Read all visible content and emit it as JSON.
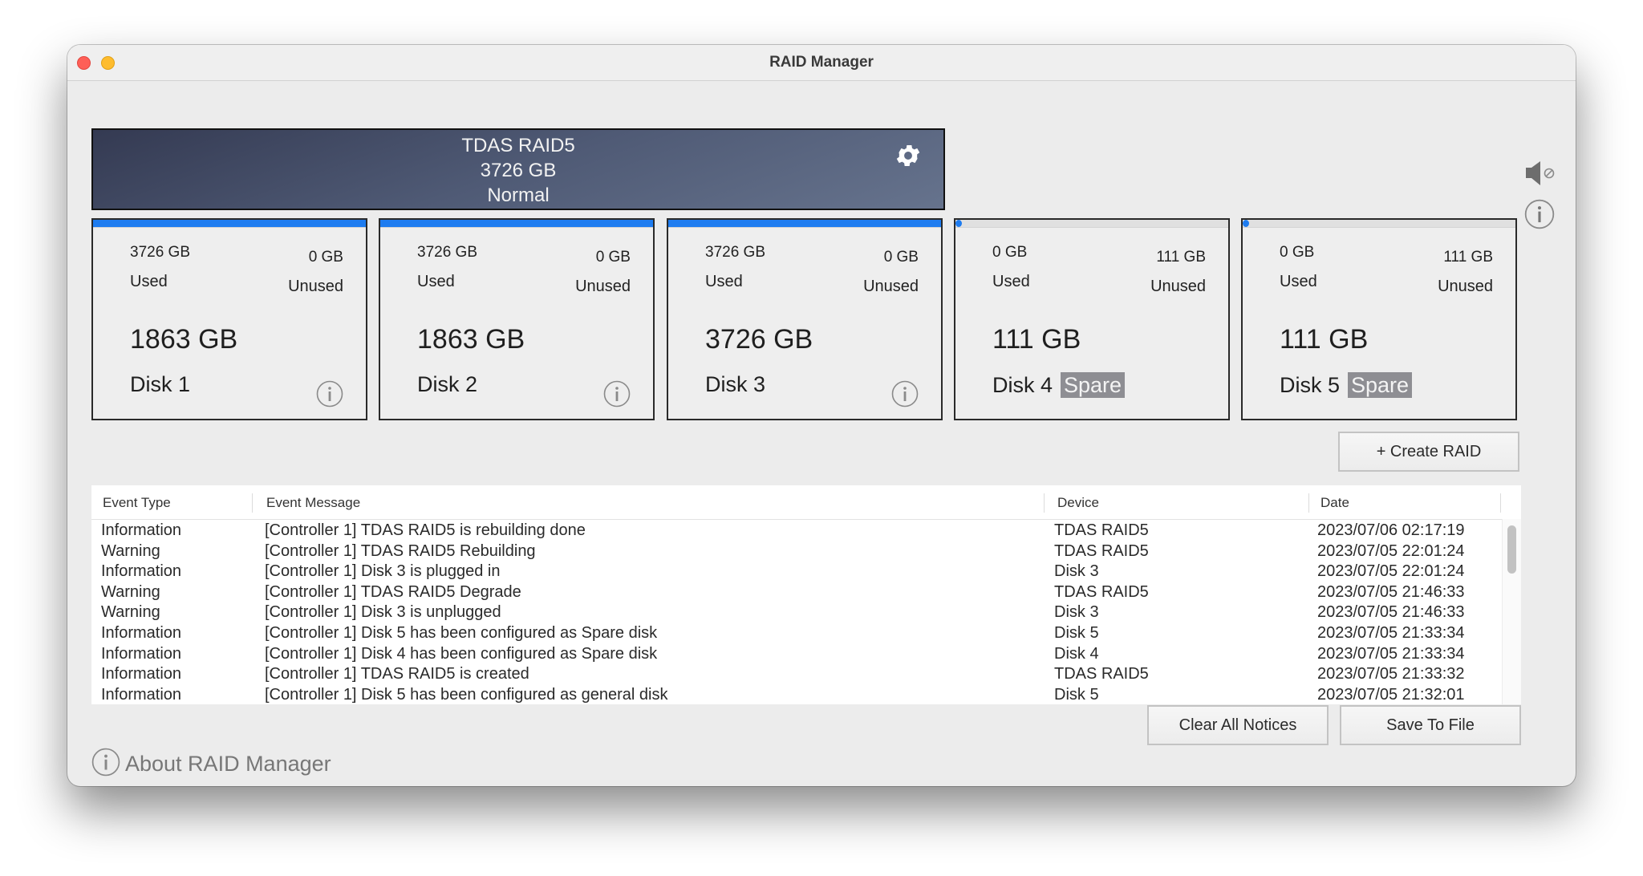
{
  "window": {
    "title": "RAID Manager"
  },
  "raid": {
    "name": "TDAS RAID5",
    "capacity": "3726 GB",
    "status": "Normal"
  },
  "colors": {
    "accent_blue": "#1e7cf0",
    "close": "#fe5f57",
    "minimize": "#febc2e",
    "spare_badge": "#8e8e93"
  },
  "disks": [
    {
      "used_value": "3726 GB",
      "used_label": "Used",
      "unused_value": "0 GB",
      "unused_label": "Unused",
      "size": "1863 GB",
      "name": "Disk 1",
      "badge": "",
      "used_fraction": 1.0
    },
    {
      "used_value": "3726 GB",
      "used_label": "Used",
      "unused_value": "0 GB",
      "unused_label": "Unused",
      "size": "1863 GB",
      "name": "Disk 2",
      "badge": "",
      "used_fraction": 1.0
    },
    {
      "used_value": "3726 GB",
      "used_label": "Used",
      "unused_value": "0 GB",
      "unused_label": "Unused",
      "size": "3726 GB",
      "name": "Disk 3",
      "badge": "",
      "used_fraction": 1.0
    },
    {
      "used_value": "0 GB",
      "used_label": "Used",
      "unused_value": "111 GB",
      "unused_label": "Unused",
      "size": "111 GB",
      "name": "Disk 4",
      "badge": "Spare",
      "used_fraction": 0.0
    },
    {
      "used_value": "0 GB",
      "used_label": "Used",
      "unused_value": "111 GB",
      "unused_label": "Unused",
      "size": "111 GB",
      "name": "Disk 5",
      "badge": "Spare",
      "used_fraction": 0.0
    }
  ],
  "actions": {
    "create_raid": "+ Create RAID",
    "clear_all": "Clear All Notices",
    "save_to_file": "Save To File",
    "about": "About RAID Manager"
  },
  "events": {
    "columns": [
      "Event Type",
      "Event Message",
      "Device",
      "Date"
    ],
    "rows": [
      [
        "Information",
        "[Controller 1] TDAS RAID5 is rebuilding done",
        "TDAS RAID5",
        "2023/07/06 02:17:19"
      ],
      [
        "Warning",
        "[Controller 1] TDAS RAID5 Rebuilding",
        "TDAS RAID5",
        "2023/07/05 22:01:24"
      ],
      [
        "Information",
        "[Controller 1] Disk 3 is plugged in",
        "Disk 3",
        "2023/07/05 22:01:24"
      ],
      [
        "Warning",
        "[Controller 1] TDAS RAID5 Degrade",
        "TDAS RAID5",
        "2023/07/05 21:46:33"
      ],
      [
        "Warning",
        "[Controller 1] Disk 3 is unplugged",
        "Disk 3",
        "2023/07/05 21:46:33"
      ],
      [
        "Information",
        "[Controller 1] Disk 5 has been configured as Spare disk",
        "Disk 5",
        "2023/07/05 21:33:34"
      ],
      [
        "Information",
        "[Controller 1] Disk 4 has been configured as Spare disk",
        "Disk 4",
        "2023/07/05 21:33:34"
      ],
      [
        "Information",
        "[Controller 1] TDAS RAID5 is created",
        "TDAS RAID5",
        "2023/07/05 21:33:32"
      ],
      [
        "Information",
        "[Controller 1] Disk 5 has been configured as general disk",
        "Disk 5",
        "2023/07/05 21:32:01"
      ]
    ]
  },
  "icons": {
    "gear": "gear-icon",
    "mute": "speaker-muted-icon",
    "info": "info-icon"
  }
}
